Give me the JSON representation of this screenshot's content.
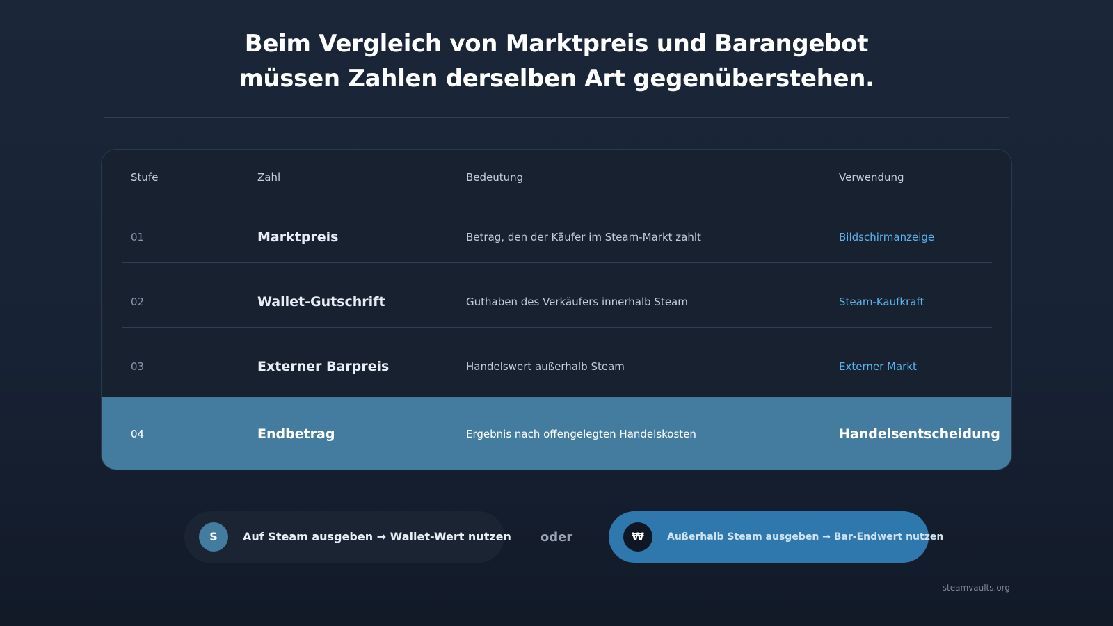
{
  "heading": {
    "line1": "Beim Vergleich von Marktpreis und Barangebot",
    "line2": "müssen Zahlen derselben Art gegenüberstehen."
  },
  "table": {
    "headers": {
      "step": "Stufe",
      "number": "Zahl",
      "meaning": "Bedeutung",
      "usage": "Verwendung"
    },
    "rows": [
      {
        "step": "01",
        "number": "Marktpreis",
        "meaning": "Betrag, den der Käufer im Steam-Markt zahlt",
        "usage": "Bildschirmanzeige"
      },
      {
        "step": "02",
        "number": "Wallet-Gutschrift",
        "meaning": "Guthaben des Verkäufers innerhalb Steam",
        "usage": "Steam-Kaufkraft"
      },
      {
        "step": "03",
        "number": "Externer Barpreis",
        "meaning": "Handelswert außerhalb Steam",
        "usage": "Externer Markt"
      },
      {
        "step": "04",
        "number": "Endbetrag",
        "meaning": "Ergebnis nach offengelegten Handelskosten",
        "usage": "Handelsentscheidung"
      }
    ],
    "highlighted_row": "04"
  },
  "options": {
    "left": {
      "icon": "S",
      "label": "Auf Steam ausgeben → Wallet-Wert nutzen"
    },
    "separator": "oder",
    "right": {
      "icon": "₩",
      "label": "Außerhalb Steam ausgeben → Bar-Endwert nutzen"
    }
  },
  "footer": {
    "site": "steamvaults.org"
  },
  "colors": {
    "background": "#172234",
    "accent": "#447c9f",
    "link": "#59b4f0",
    "pill_primary": "#2f78ad"
  }
}
